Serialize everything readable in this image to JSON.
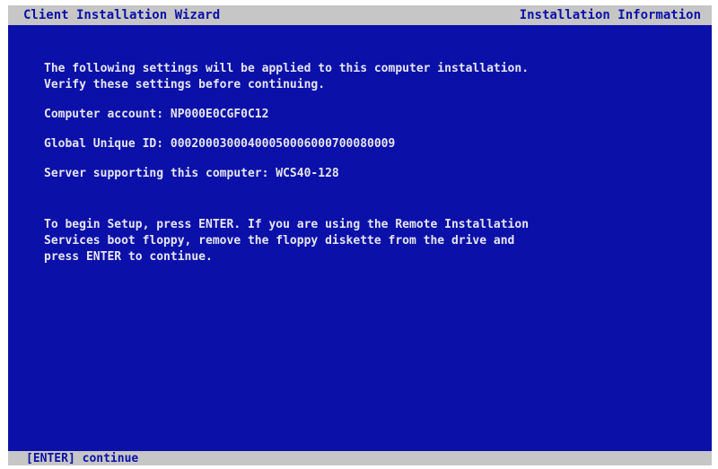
{
  "header": {
    "title": "Client Installation Wizard",
    "section": "Installation Information"
  },
  "intro": {
    "line1": "The following settings will be applied to this computer installation.",
    "line2": "Verify these settings before continuing."
  },
  "settings": {
    "computer_account": "Computer account: NP000E0CGF0C12",
    "guid": "Global Unique ID: 00020003000400050006000700080009",
    "server": "Server supporting this computer: WCS40-128"
  },
  "instructions": {
    "line1": "To begin Setup, press ENTER. If you are using the Remote Installation",
    "line2": "Services boot floppy, remove the floppy diskette from the drive and",
    "line3": "press ENTER to continue."
  },
  "footer": {
    "hint": "[ENTER] continue"
  },
  "colors": {
    "background": "#0b10a8",
    "bar": "#c6c6c6",
    "text": "#e6e6ee"
  }
}
